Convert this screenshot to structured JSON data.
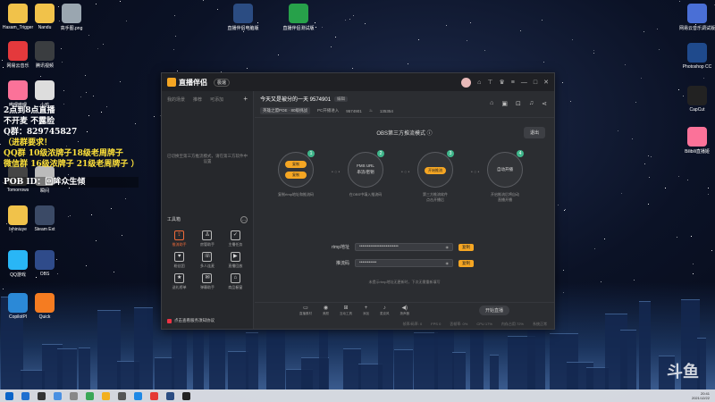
{
  "desktop": {
    "icons_left": [
      {
        "label": "Hasam_Trigger",
        "color": "#f1c24a"
      },
      {
        "label": "Nandu",
        "color": "#f1c24a"
      },
      {
        "label": "高手图.png",
        "color": "#9aa6b0"
      },
      {
        "label": "网易云音乐",
        "color": "#e4393c"
      },
      {
        "label": "腾讯视频",
        "color": "#3a3d40"
      },
      {
        "label": "哔哩哔哩",
        "color": "#fb7299"
      },
      {
        "label": "小鸡",
        "color": "#ddd"
      },
      {
        "label": "Ishiniuye",
        "color": "#f1c24a"
      },
      {
        "label": "Steam Ext",
        "color": "#3b4a66"
      },
      {
        "label": "Tomorrows",
        "color": "#444"
      },
      {
        "label": "瞬间",
        "color": "#bbb"
      },
      {
        "label": "QQ游戏",
        "color": "#29b6f6"
      },
      {
        "label": "OBS",
        "color": "#2f4b8a"
      },
      {
        "label": "CopilotPl",
        "color": "#2b89d7"
      },
      {
        "label": "Quick",
        "color": "#f57c21"
      }
    ],
    "icons_top": [
      {
        "label": "直播伴侣电脑版",
        "color": "#2b4c82"
      },
      {
        "label": "直播伴侣测试版",
        "color": "#27a14a"
      }
    ],
    "icons_right": [
      {
        "label": "网易云音乐调试版",
        "color": "#4a6fd6"
      },
      {
        "label": "Photoshop CC",
        "color": "#1f4a8c"
      },
      {
        "label": "CapCut",
        "color": "#222"
      },
      {
        "label": "Bilibili直播姬",
        "color": "#fb7299"
      }
    ],
    "overlay_lines": [
      "2点到8点直播",
      "不开麦 不露脸",
      "Q群：829745827",
      "（进群要求！",
      "QQ群 10级浓牌子18级老周牌子",
      "微信群 16级浓牌子 21级老周牌子 ）",
      "POB ID：回眸众生倾"
    ],
    "watermark": "斗鱼"
  },
  "app": {
    "brand": "直播伴侣",
    "version_badge": "极速",
    "titlebar_icons": [
      "gift-icon",
      "shirt-icon",
      "crown-icon",
      "menu-icon",
      "minimize-icon",
      "maximize-icon",
      "close-icon"
    ],
    "left_tabs": [
      "我的场景",
      "推荐",
      "可添加"
    ],
    "left_empty_text": "已切换至第三方推流模式，请在第三方软件中设置",
    "tools_title": "工具箱",
    "tools": [
      {
        "label": "推流助手",
        "glyph": "⇪",
        "active": true
      },
      {
        "label": "房管助手",
        "glyph": "♙",
        "active": false
      },
      {
        "label": "主播任务",
        "glyph": "✓",
        "active": false
      },
      {
        "label": "粉丝团",
        "glyph": "♥",
        "active": false
      },
      {
        "label": "多人连麦",
        "glyph": "☏",
        "active": false
      },
      {
        "label": "直播回放",
        "glyph": "▶",
        "active": false
      },
      {
        "label": "送礼榜单",
        "glyph": "★",
        "active": false
      },
      {
        "label": "弹幕助手",
        "glyph": "✉",
        "active": false
      },
      {
        "label": "商品橱窗",
        "glyph": "⌂",
        "active": false
      }
    ],
    "notice": "点击查看服务须知协议",
    "header": {
      "title": "今天又是被分的一天 9574901",
      "title_tag": "编辑",
      "category": "英雄之盟POE · 80级挑战",
      "room_label": "PC开播进入",
      "room_id": "9574901",
      "fans": "135354"
    },
    "obs": {
      "mode_title": "OBS第三方推流模式",
      "exit_label": "退出",
      "steps": [
        {
          "num": "1",
          "pills": [
            "复制",
            "复制"
          ],
          "desc": "复制rtmp地址和推流码"
        },
        {
          "num": "2",
          "lines": [
            "FMS URL",
            "串流/密钥"
          ],
          "desc": "在OBS中填入推流码"
        },
        {
          "num": "3",
          "pill": "开始推流",
          "desc": "第三方推流软件\n点击开播后"
        },
        {
          "num": "4",
          "text": "自动开播",
          "desc": "开启推流后将自动\n直播开播"
        }
      ],
      "rtmp_label": "rtmp地址",
      "rtmp_value": "•••••••••••••••••••••••••",
      "key_label": "推流码",
      "key_value": "•••••••••••",
      "copy_label": "复制",
      "hint": "未提示rtmp地址无更新时，下次无需重新填写"
    },
    "toolbar": [
      {
        "label": "直播素材",
        "glyph": "▭"
      },
      {
        "label": "美颜",
        "glyph": "◉"
      },
      {
        "label": "互动工具",
        "glyph": "⊞"
      },
      {
        "label": "添加",
        "glyph": "+"
      },
      {
        "label": "麦克风",
        "glyph": "♪"
      },
      {
        "label": "扬声器",
        "glyph": "◀)"
      }
    ],
    "start_label": "开始直播",
    "status": [
      "帧率/码率: 0",
      "FPS 0",
      "丢帧率: 0%",
      "CPU 17%",
      "内存占用 72%",
      "系统正常"
    ]
  },
  "taskbar": {
    "icons": [
      "#1f6fd0",
      "#333",
      "#4a90e2",
      "#888",
      "#3aa757",
      "#f2b01e",
      "#555",
      "#1e88e5",
      "#e53935",
      "#2b4c82",
      "#222"
    ],
    "time": "20:41",
    "date": "2021/12/22"
  }
}
